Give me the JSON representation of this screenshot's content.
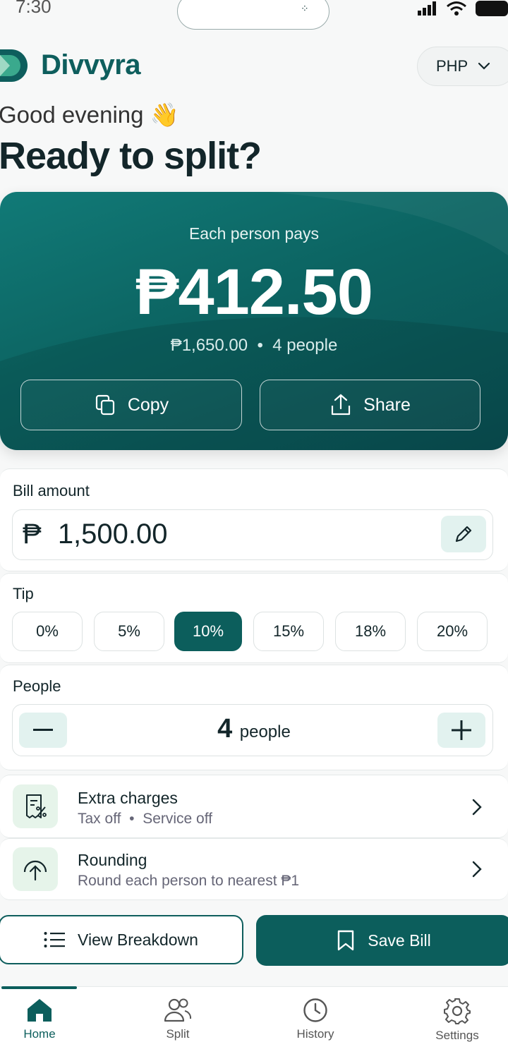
{
  "status": {
    "time": "7:30"
  },
  "header": {
    "brand": "Divvyra",
    "currency": "PHP"
  },
  "greeting": {
    "line1": "Good evening 👋",
    "line2": "Ready to split?"
  },
  "hero": {
    "label": "Each person pays",
    "amount": "₱412.50",
    "total": "₱1,650.00",
    "people": "4 people",
    "copy_label": "Copy",
    "share_label": "Share"
  },
  "bill": {
    "label": "Bill amount",
    "currency_symbol": "₱",
    "value": "1,500.00"
  },
  "tip": {
    "label": "Tip",
    "options": [
      "0%",
      "5%",
      "10%",
      "15%",
      "18%",
      "20%"
    ],
    "selected": "10%"
  },
  "people": {
    "label": "People",
    "count": "4",
    "unit": "people"
  },
  "extra_charges": {
    "title": "Extra charges",
    "tax": "Tax off",
    "service": "Service off"
  },
  "rounding": {
    "title": "Rounding",
    "subtitle": "Round each person to nearest ₱1"
  },
  "actions": {
    "breakdown_label": "View Breakdown",
    "save_label": "Save Bill"
  },
  "nav": {
    "items": [
      {
        "label": "Home",
        "icon": "home-icon"
      },
      {
        "label": "Split",
        "icon": "users-icon"
      },
      {
        "label": "History",
        "icon": "clock-icon"
      },
      {
        "label": "Settings",
        "icon": "gear-icon"
      }
    ],
    "active": "Home"
  },
  "colors": {
    "primary": "#0c5e5c",
    "accent_bg": "#e2f2ef",
    "text": "#13262a"
  }
}
